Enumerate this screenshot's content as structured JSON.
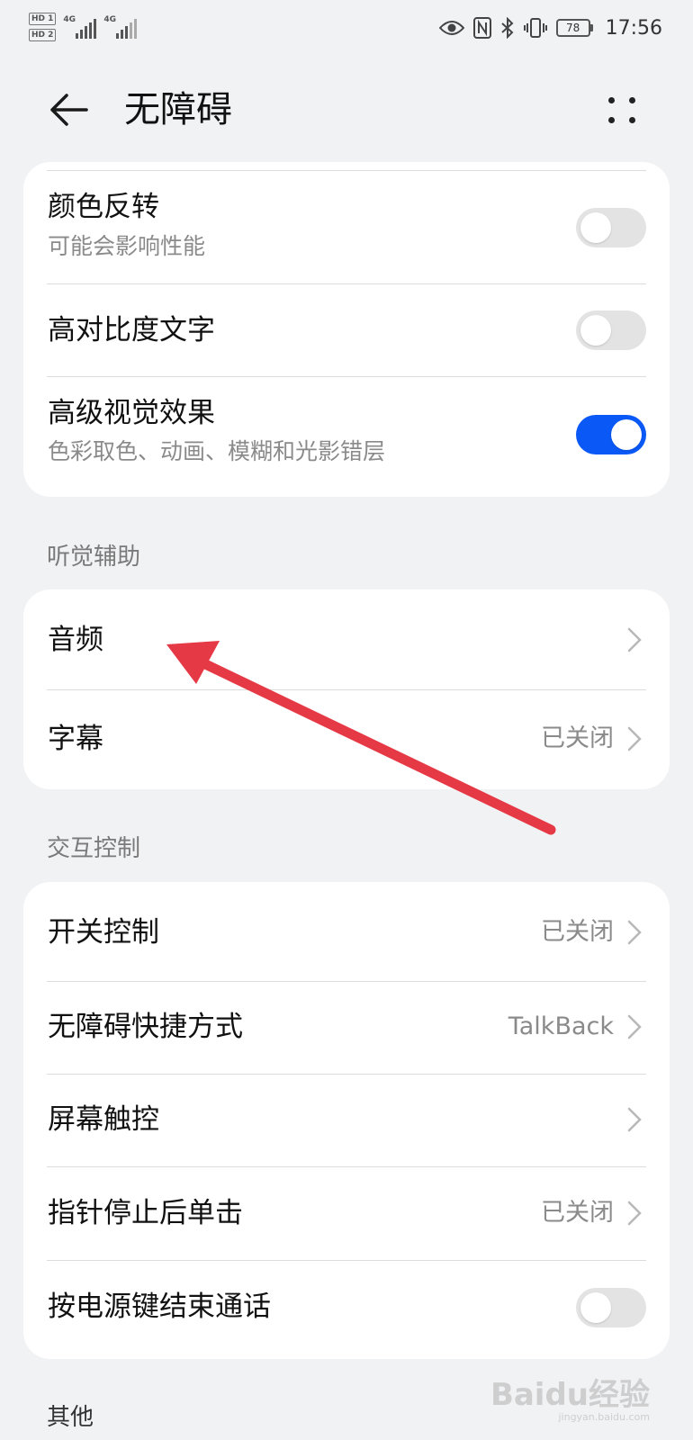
{
  "status_bar": {
    "sim1": "HD 1",
    "sim2": "HD 2",
    "net1": "4G",
    "net2": "4G",
    "battery": "78",
    "time": "17:56"
  },
  "header": {
    "title": "无障碍"
  },
  "vision_card": {
    "items": [
      {
        "label": "颜色反转",
        "sub": "可能会影响性能",
        "toggle": "off"
      },
      {
        "label": "高对比度文字",
        "toggle": "off"
      },
      {
        "label": "高级视觉效果",
        "sub": "色彩取色、动画、模糊和光影错层",
        "toggle": "on"
      }
    ]
  },
  "hearing": {
    "header": "听觉辅助",
    "items": [
      {
        "label": "音频",
        "value": ""
      },
      {
        "label": "字幕",
        "value": "已关闭"
      }
    ]
  },
  "interaction": {
    "header": "交互控制",
    "items": [
      {
        "label": "开关控制",
        "value": "已关闭"
      },
      {
        "label": "无障碍快捷方式",
        "value": "TalkBack"
      },
      {
        "label": "屏幕触控",
        "value": ""
      },
      {
        "label": "指针停止后单击",
        "value": "已关闭"
      },
      {
        "label": "按电源键结束通话",
        "toggle": "off"
      }
    ]
  },
  "other": {
    "header": "其他"
  },
  "watermark": {
    "text": "Baidu经验",
    "sub": "jingyan.baidu.com"
  },
  "colors": {
    "accent": "#0a59f7",
    "annotation": "#e63946",
    "background": "#f1f2f4"
  },
  "icons": {
    "back": "back-arrow-icon",
    "more": "more-dots-icon",
    "chevron": "chevron-right-icon"
  }
}
